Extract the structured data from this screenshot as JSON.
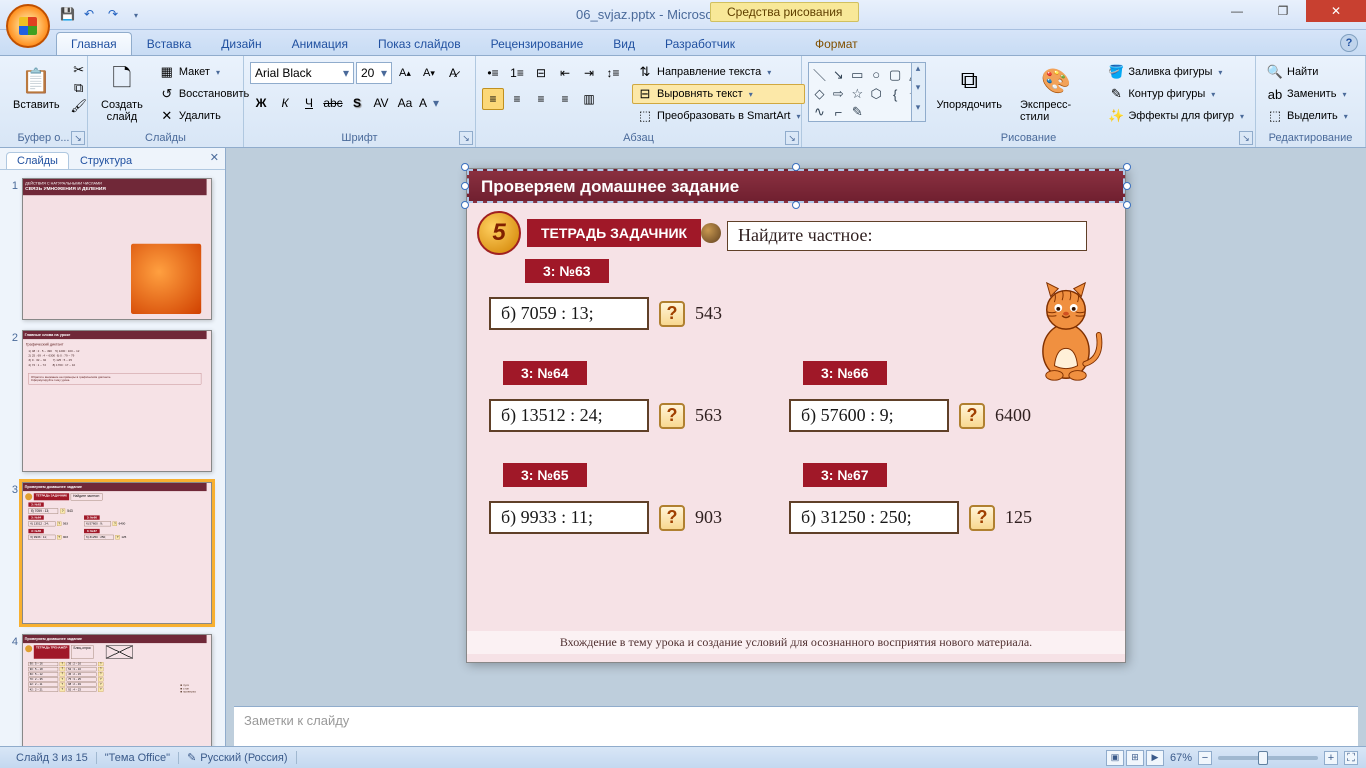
{
  "title": {
    "filename": "06_svjaz.pptx",
    "app": "Microsoft PowerPoint"
  },
  "contextual_header": "Средства рисования",
  "tabs": {
    "home": "Главная",
    "insert": "Вставка",
    "design": "Дизайн",
    "animation": "Анимация",
    "slideshow": "Показ слайдов",
    "review": "Рецензирование",
    "view": "Вид",
    "developer": "Разработчик",
    "format": "Формат"
  },
  "ribbon": {
    "clipboard": {
      "label": "Буфер о...",
      "paste": "Вставить"
    },
    "slides": {
      "label": "Слайды",
      "new": "Создать\nслайд",
      "layout": "Макет",
      "reset": "Восстановить",
      "delete": "Удалить"
    },
    "font": {
      "label": "Шрифт",
      "name": "Arial Black",
      "size": "20"
    },
    "paragraph": {
      "label": "Абзац",
      "direction": "Направление текста",
      "align": "Выровнять текст",
      "smartart": "Преобразовать в SmartArt"
    },
    "drawing": {
      "label": "Рисование",
      "arrange": "Упорядочить",
      "styles": "Экспресс-стили",
      "fill": "Заливка фигуры",
      "outline": "Контур фигуры",
      "effects": "Эффекты для фигур"
    },
    "editing": {
      "label": "Редактирование",
      "find": "Найти",
      "replace": "Заменить",
      "select": "Выделить"
    }
  },
  "panel": {
    "slides_tab": "Слайды",
    "outline_tab": "Структура"
  },
  "thumbs": {
    "t1_line1": "ДЕЙСТВИЯ С НАТУРАЛЬНЫМИ ЧИСЛАМИ",
    "t1_line2": "СВЯЗЬ УМНОЖЕНИЯ И ДЕЛЕНИЯ",
    "t2_title": "Главные слова на уроке",
    "t2_sub": "Графический диктант",
    "t3_title": "Проверяем домашнее задание",
    "t4_title": "Проверяем домашнее задание"
  },
  "slide": {
    "title": "Проверяем домашнее задание",
    "badge_label": "ТЕТРАДЬ ЗАДАЧНИК",
    "badge_num": "5",
    "task_title": "Найдите частное:",
    "tag63": "3: №63",
    "p63": "б) 7059 : 13;",
    "a63": "543",
    "tag64": "3: №64",
    "p64": "б) 13512 : 24;",
    "a64": "563",
    "tag65": "3: №65",
    "p65": "б) 9933 : 11;",
    "a65": "903",
    "tag66": "3: №66",
    "p66": "б) 57600 : 9;",
    "a66": "6400",
    "tag67": "3: №67",
    "p67": "б) 31250 : 250;",
    "a67": "125",
    "q": "?",
    "footer": "Вхождение в тему урока и создание условий для осознанного восприятия нового материала."
  },
  "notes_placeholder": "Заметки к слайду",
  "status": {
    "slide_pos": "Слайд 3 из 15",
    "theme": "\"Тема Office\"",
    "lang": "Русский (Россия)",
    "zoom": "67%"
  }
}
